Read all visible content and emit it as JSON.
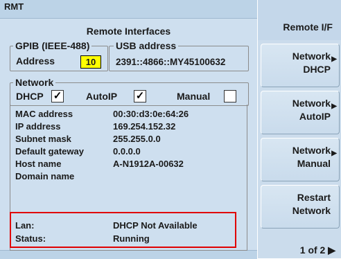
{
  "mode_label": "RMT",
  "title": "Remote Interfaces",
  "gpib": {
    "legend": "GPIB (IEEE-488)",
    "address_label": "Address",
    "address_value": "10"
  },
  "usb": {
    "legend": "USB address",
    "value": "2391::4866::MY45100632"
  },
  "network": {
    "legend": "Network",
    "dhcp_label": "DHCP",
    "dhcp_checked": true,
    "autoip_label": "AutoIP",
    "autoip_checked": true,
    "manual_label": "Manual",
    "manual_checked": false,
    "check_glyph": "✓"
  },
  "info": [
    {
      "label": "MAC address",
      "value": "00:30:d3:0e:64:26"
    },
    {
      "label": "IP address",
      "value": "169.254.152.32"
    },
    {
      "label": "Subnet mask",
      "value": "255.255.0.0"
    },
    {
      "label": "Default gateway",
      "value": "0.0.0.0"
    },
    {
      "label": "Host name",
      "value": "A-N1912A-00632"
    },
    {
      "label": "Domain name",
      "value": ""
    }
  ],
  "status": [
    {
      "label": "Lan:",
      "value": "DHCP Not Available"
    },
    {
      "label": "Status:",
      "value": "Running"
    }
  ],
  "softpanel": {
    "title": "Remote I/F",
    "keys": [
      {
        "line1": "Network",
        "line2": "DHCP",
        "arrow": "▶"
      },
      {
        "line1": "Network",
        "line2": "AutoIP",
        "arrow": "▶"
      },
      {
        "line1": "Network",
        "line2": "Manual",
        "arrow": "▶"
      },
      {
        "line1": "Restart",
        "line2": "Network",
        "arrow": ""
      }
    ],
    "pager": "1 of 2 ▶"
  },
  "colors": {
    "display_bg": "#cedfef",
    "highlight_box": "#e00000",
    "address_bg": "#ffff00"
  }
}
